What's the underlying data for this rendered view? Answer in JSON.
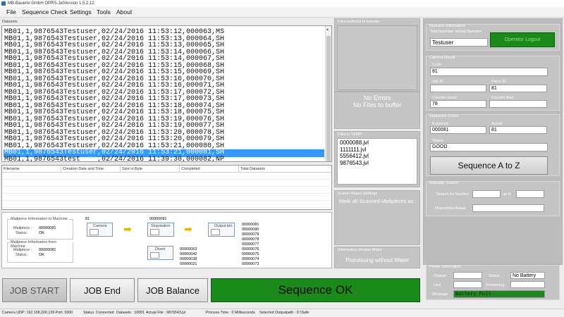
{
  "window": {
    "title": "MB-Bauerle GmbH OPRS-JetVersion 1.5.2.12"
  },
  "menu": [
    "File",
    "Sequence Check",
    "Settings",
    "Tools",
    "About"
  ],
  "datasets": {
    "title": "Datasets",
    "lines": [
      "MB01,1,9876543Testuser,02/24/2016 11:53:12,000063,MS",
      "MB01,1,9876543Testuser,02/24/2016 11:53:13,000064,SH",
      "MB01,1,9876543Testuser,02/24/2016 11:53:13,000065,SH",
      "MB01,1,9876543Testuser,02/24/2016 11:53:14,000066,SH",
      "MB01,1,9876543Testuser,02/24/2016 11:53:14,000067,SH",
      "MB01,1,9876543Testuser,02/24/2016 11:53:15,000068,SH",
      "MB01,1,9876543Testuser,02/24/2016 11:53:15,000069,SH",
      "MB01,1,9876543Testuser,02/24/2016 11:53:16,000070,SH",
      "MB01,1,9876543Testuser,02/24/2016 11:53:16,000071,SH",
      "MB01,1,9876543Testuser,02/24/2016 11:53:17,000072,SH",
      "MB01,1,9876543Testuser,02/24/2016 11:53:17,000073,SH",
      "MB01,1,9876543Testuser,02/24/2016 11:53:18,000074,SH",
      "MB01,1,9876543Testuser,02/24/2016 11:53:18,000075,SH",
      "MB01,1,9876543Testuser,02/24/2016 11:53:19,000076,SH",
      "MB01,1,9876543Testuser,02/24/2016 11:53:19,000077,SH",
      "MB01,1,9876543Testuser,02/24/2016 11:53:20,000078,SH",
      "MB01,1,9876543Testuser,02/24/2016 11:53:20,000079,SH",
      "MB01,1,9876543Testuser,02/24/2016 11:53:21,000080,SH",
      "MB01,1,9876543Testuser,02/24/2016 11:53:21,000081,SH",
      "MB01,1,9876543test    ,02/24/2016 11:39:30,000082,NP"
    ]
  },
  "files_table": {
    "columns": [
      "Filename",
      "Creation Date and Time",
      "Size in Byte",
      "Completed",
      "Total Datasets"
    ]
  },
  "mailpiece_flow": {
    "to_machine": {
      "title": "Mailpiece Information to Machine",
      "mailpiece_label": "Mailpiece :",
      "mailpiece_value": "00000081",
      "status_label": "Status :",
      "status_value": "OK"
    },
    "from_machine": {
      "title": "Mailpiece Information from Machine",
      "mailpiece_label": "Mailpiece :",
      "mailpiece_value": "00000081",
      "status_label": "Status :",
      "status_value": "OK"
    },
    "camera_count": "81",
    "camera_label": "Camera",
    "stopstation_count": "00000081",
    "stopstation_label": "Stopstation",
    "output_bin_label": "Output bin",
    "divert_label": "Divert",
    "divert_list": [
      "00000063",
      "00000042",
      "00000038",
      "00000021"
    ],
    "output_list": [
      "00000081",
      "00000080",
      "00000079",
      "00000078",
      "00000077",
      "00000076",
      "00000075",
      "00000074",
      "00000073"
    ]
  },
  "buffer": {
    "title": "Files buffered to transfer",
    "line1": "No Errors",
    "line2": "No Files to buffer"
  },
  "temp": {
    "title": "Files in TEMP",
    "files": [
      "0000088.jvl",
      "1111111.jvl",
      "5556412.jvl",
      "9876543.jvl"
    ]
  },
  "scanner": {
    "title": "Scaner Reject Settings",
    "text": "Mark all Scanned Mailpieces as :"
  },
  "meter": {
    "title": "Information Version Meter",
    "text": "Processing without Meter"
  },
  "operator": {
    "title": "Operator Information",
    "label": "Batchnumber actual Operator",
    "value": "Testuser",
    "logout": "Operator Logout"
  },
  "camera_result": {
    "title": "Camera Result",
    "code_label": "Code",
    "code_value": "81",
    "job_id_label": "Job ID",
    "job_id_value": "",
    "piece_id_label": "Piece ID",
    "piece_id_value": "81",
    "counter_good_label": "Counter Good",
    "counter_good_value": "78",
    "counter_bad_label": "Counter Bad",
    "counter_bad_value": ""
  },
  "sequence_check": {
    "title": "Sequence Check",
    "expected_label": "Expected",
    "expected_value": "000081",
    "actual_label": "Actual",
    "actual_value": "81",
    "status_label": "Status",
    "status_value": "GOOD",
    "button": "Sequence A to Z"
  },
  "manual_search": {
    "title": "Manually Search",
    "search_label": "Search for Number",
    "up_to": "up to",
    "disposition_label": "Disposition Actual"
  },
  "power": {
    "title": "Power Information",
    "charge_label": "Charge",
    "charge_value": "",
    "status_label": "Status",
    "status_value": "No Battery",
    "line_label": "Line",
    "line_value": "",
    "remaining_label": "Remaining",
    "remaining_value": "",
    "message_label": "Message",
    "message_value": "Battery Full"
  },
  "buttons": {
    "job_start": "JOB START",
    "job_end": "JOB End",
    "job_balance": "JOB Balance",
    "sequence_ok": "Sequence OK"
  },
  "statusbar": {
    "camera": "Camera UDP: 192.168.200.139 Port: 9300",
    "status": "Status: Connected",
    "datasets": "Datasets : 10001",
    "actual_file": "Actual File : 9876543.jvl",
    "process_time": "Process Time : 0 Milliseconds",
    "output_path": "Selected Outputpath : D:\\Safe"
  },
  "colors": {
    "selection": "#3399ff",
    "green": "#1a8a1a",
    "panel_grey": "#c4c4c4",
    "arrow": "#e8b400"
  }
}
